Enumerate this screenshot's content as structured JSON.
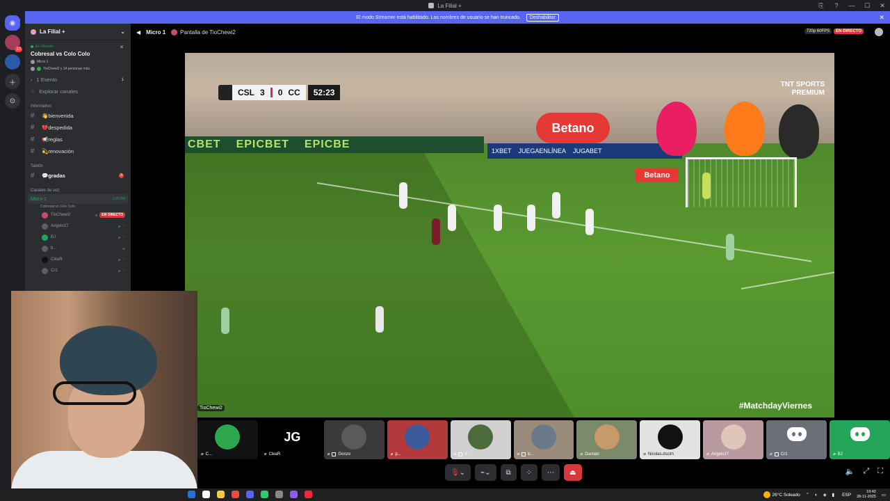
{
  "window": {
    "title": "La Filial +",
    "controls": [
      "⎘",
      "?",
      "—",
      "☐",
      "✕"
    ]
  },
  "rail": {
    "badge_count": "10"
  },
  "banner": {
    "message": "El modo Streamer está habilitado. Los nombres de usuario se han truncado.",
    "disable_label": "Deshabilitar",
    "close": "✕"
  },
  "sidebar": {
    "server_name": "La Filial +",
    "chevron": "⌄",
    "event": {
      "status": "En Directo",
      "title": "Cobresal vs Colo Colo",
      "channel": "Micro 1",
      "people": "TioChewi2 y 14 personas más",
      "close": "✕"
    },
    "events_label": "1 Evento",
    "events_count": "1",
    "explore_label": "Explorar canales",
    "category_info": "Informativo",
    "info_channels": [
      {
        "name": "👋bienvenida"
      },
      {
        "name": "💔despedida"
      },
      {
        "name": "📢reglas"
      },
      {
        "name": "💫renovación"
      }
    ],
    "category_board": "Tablón",
    "board_channel": "💬gradas",
    "board_badge": "9",
    "category_voice": "Canales de voz",
    "voice_channel": "Micro 1",
    "voice_time": "1:20:59",
    "voice_sub": "Cobresal vs Colo Colo",
    "members": [
      {
        "name": "TioChewi2",
        "live": "EN DIRECTO"
      },
      {
        "name": "Angelo17",
        "live": ""
      },
      {
        "name": "BJ",
        "live": ""
      },
      {
        "name": "b...",
        "live": ""
      },
      {
        "name": "CleaR",
        "live": ""
      },
      {
        "name": "Cr1",
        "live": ""
      }
    ]
  },
  "main": {
    "channel": "Micro 1",
    "share_title": "Pantalla de TioChewi2",
    "quality": "720p 60FPS",
    "live": "EN DIRECTO",
    "stream_owner": "TioChewi2"
  },
  "video": {
    "score_home": "CSL",
    "score_home_goals": "3",
    "score_away_goals": "0",
    "score_away": "CC",
    "clock": "52:23",
    "board_text": [
      "CBET",
      "EPICBET",
      "EPICBE"
    ],
    "sponsor_1": "Betano",
    "sponsor_2": "Betano",
    "sponsor_row": [
      "1XBET",
      "JUEGAENLÍNEA",
      "JUGABET"
    ],
    "broadcaster": "TNT SPORTS",
    "broadcaster_sub": "PREMIUM",
    "hashtag": "#MatchdayViernes"
  },
  "participants": [
    {
      "name": "C...",
      "type": "avatar",
      "color": "#2ea84f"
    },
    {
      "name": "CleaR",
      "type": "logo",
      "color": "#000000"
    },
    {
      "name": "Gonzo",
      "type": "photo",
      "color": "#4a4a4a"
    },
    {
      "name": "p...",
      "type": "photo",
      "color": "#b23a3a"
    },
    {
      "name": "J...",
      "type": "photo",
      "color": "#c8c8c8"
    },
    {
      "name": "b...",
      "type": "photo",
      "color": "#8a7a6a"
    },
    {
      "name": "Damian",
      "type": "photo",
      "color": "#9a8a7a"
    },
    {
      "name": "Nicolas.dscim",
      "type": "photo",
      "color": "#d8d8d8"
    },
    {
      "name": "Angelo17",
      "type": "photo",
      "color": "#b89aa0"
    },
    {
      "name": "Cr1",
      "type": "discord",
      "color": "#6d6f78"
    },
    {
      "name": "BJ",
      "type": "discord",
      "color": "#23a55a"
    }
  ],
  "controls": {
    "mic": "🎙",
    "camera": "⌁",
    "screen": "⧉",
    "activities": "⁘",
    "more": "⋯",
    "leave": "⏏"
  },
  "right_controls": [
    "🔈",
    "⤢",
    "⛶"
  ],
  "taskbar": {
    "weather": "26°C Soleado",
    "lang": "ESP",
    "time": "19:42",
    "date": "28-11-2025",
    "apps": [
      "#2b6fd6",
      "#ffffff",
      "#f2c94c",
      "#e74c3c",
      "#5865f2",
      "#2ecc71",
      "#888888",
      "#8b5cf6",
      "#fa243c"
    ]
  }
}
